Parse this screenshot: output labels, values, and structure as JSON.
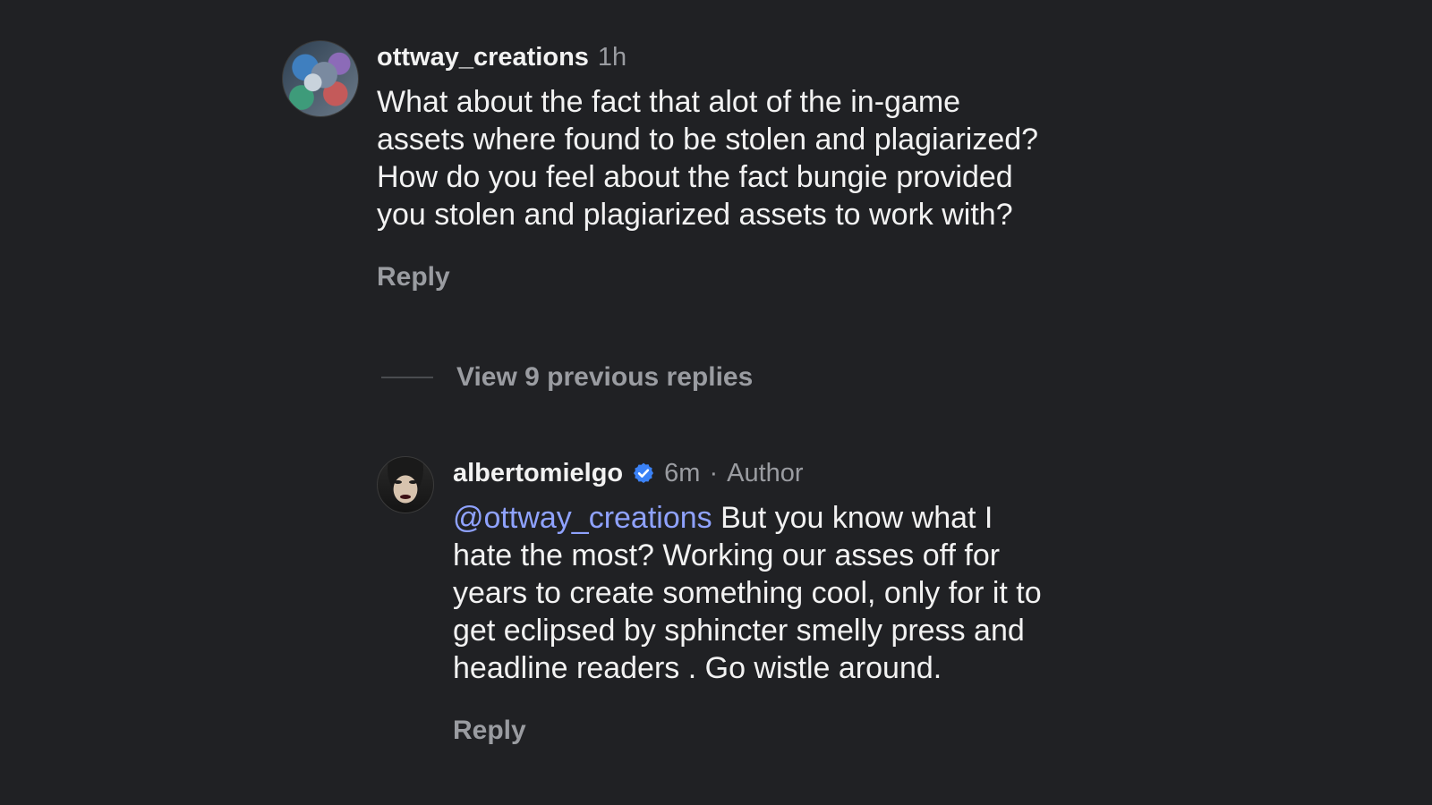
{
  "comments": [
    {
      "username": "ottway_creations",
      "time": "1h",
      "text": "What about the fact that alot of the in-game assets where found to be stolen and plagiarized? How do you feel about the fact bungie provided you stolen and plagiarized assets to work with?",
      "reply_label": "Reply"
    },
    {
      "username": "albertomielgo",
      "verified": true,
      "time": "6m",
      "separator": "·",
      "author_tag": "Author",
      "mention": "@ottway_creations",
      "text": "But you know what I hate the most? Working our asses off for years to create something cool, only for it to get eclipsed by sphincter smelly press and headline readers . Go wistle around.",
      "reply_label": "Reply"
    }
  ],
  "view_replies_label": "View 9 previous replies",
  "colors": {
    "background": "#202124",
    "text": "#f2f2f2",
    "muted": "#9a9ca1",
    "mention": "#8fa2ff",
    "verified": "#3b82f6"
  }
}
